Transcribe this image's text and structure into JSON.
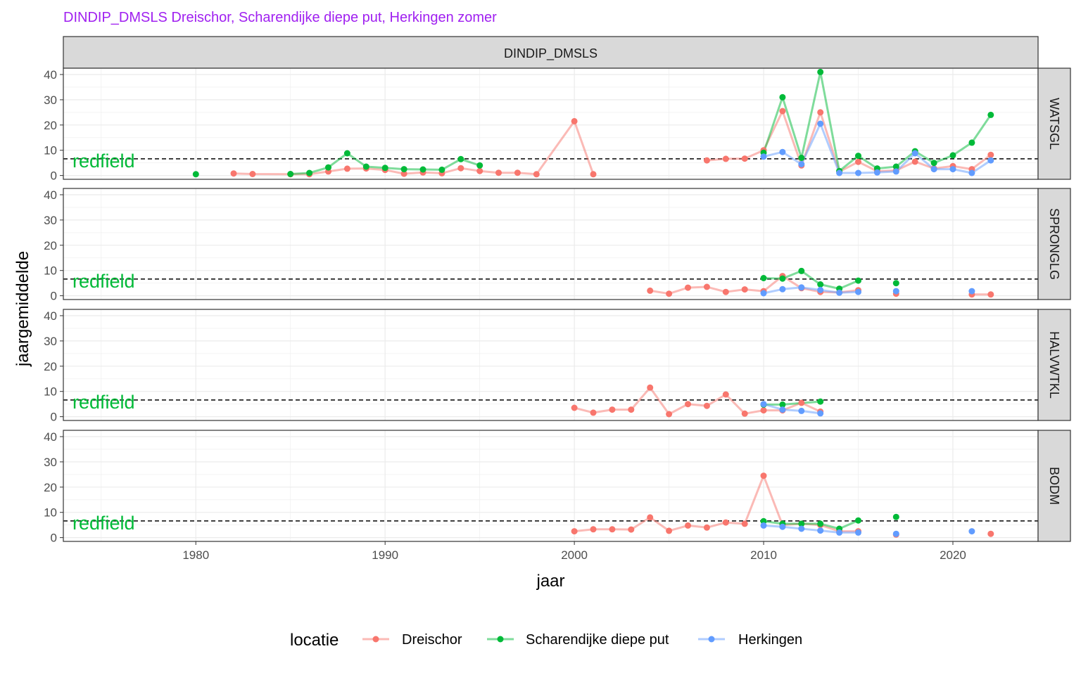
{
  "chart_data": {
    "type": "line",
    "title": "DINDIP_DMSLS Dreischor, Scharendijke diepe put, Herkingen zomer",
    "title_color": "#A020F0",
    "facet_column": "DINDIP_DMSLS",
    "xlabel": "jaar",
    "ylabel": "jaargemiddelde",
    "xlim": [
      1973,
      2024.5
    ],
    "ylim": [
      -1.5,
      42.5
    ],
    "x_ticks": [
      1980,
      1990,
      2000,
      2010,
      2020
    ],
    "y_ticks": [
      0,
      10,
      20,
      30,
      40
    ],
    "grid": true,
    "reference_line": {
      "y": 6.6,
      "label": "redfield",
      "color": "#00BA38",
      "style": "dashed"
    },
    "legend": {
      "title": "locatie",
      "position": "bottom"
    },
    "series_styles": [
      {
        "name": "Dreischor",
        "color": "#F8766D"
      },
      {
        "name": "Scharendijke diepe put",
        "color": "#00BA38"
      },
      {
        "name": "Herkingen",
        "color": "#619CFF"
      }
    ],
    "panels": [
      {
        "label": "WATSGL",
        "series": [
          {
            "name": "Dreischor",
            "segments": [
              [
                [
                  1982,
                  0.8
                ],
                [
                  1983,
                  0.6
                ],
                [
                  1985,
                  0.5
                ],
                [
                  1986,
                  0.5
                ],
                [
                  1987,
                  1.6
                ],
                [
                  1988,
                  2.7
                ],
                [
                  1989,
                  2.8
                ],
                [
                  1990,
                  2.2
                ],
                [
                  1991,
                  0.7
                ],
                [
                  1992,
                  1.2
                ],
                [
                  1993,
                  0.9
                ],
                [
                  1994,
                  2.9
                ],
                [
                  1995,
                  1.8
                ],
                [
                  1996,
                  1.1
                ],
                [
                  1997,
                  1.1
                ],
                [
                  1998,
                  0.5
                ],
                [
                  2000,
                  21.5
                ],
                [
                  2001,
                  0.5
                ]
              ],
              [
                [
                  2007,
                  6.0
                ],
                [
                  2008,
                  6.6
                ],
                [
                  2009,
                  6.7
                ],
                [
                  2010,
                  10.0
                ],
                [
                  2011,
                  25.5
                ],
                [
                  2012,
                  4.0
                ],
                [
                  2013,
                  25.0
                ],
                [
                  2014,
                  1.5
                ],
                [
                  2015,
                  5.4
                ],
                [
                  2016,
                  1.7
                ],
                [
                  2017,
                  2.0
                ],
                [
                  2018,
                  5.5
                ],
                [
                  2019,
                  2.8
                ],
                [
                  2020,
                  3.7
                ],
                [
                  2021,
                  2.5
                ],
                [
                  2022,
                  8.2
                ]
              ]
            ]
          },
          {
            "name": "Scharendijke diepe put",
            "segments": [
              [
                [
                  1980,
                  0.5
                ]
              ],
              [
                [
                  1985,
                  0.6
                ],
                [
                  1986,
                  1.0
                ],
                [
                  1987,
                  3.2
                ],
                [
                  1988,
                  8.8
                ],
                [
                  1989,
                  3.5
                ],
                [
                  1990,
                  3.0
                ],
                [
                  1991,
                  2.5
                ],
                [
                  1992,
                  2.4
                ],
                [
                  1993,
                  2.3
                ],
                [
                  1994,
                  6.5
                ],
                [
                  1995,
                  4.0
                ]
              ],
              [
                [
                  2010,
                  9.0
                ],
                [
                  2011,
                  31.0
                ],
                [
                  2012,
                  7.0
                ],
                [
                  2013,
                  41.0
                ],
                [
                  2014,
                  1.8
                ],
                [
                  2015,
                  7.8
                ],
                [
                  2016,
                  2.8
                ],
                [
                  2017,
                  3.5
                ],
                [
                  2018,
                  9.6
                ],
                [
                  2019,
                  5.0
                ],
                [
                  2020,
                  8.0
                ],
                [
                  2021,
                  13.0
                ],
                [
                  2022,
                  24.0
                ]
              ]
            ]
          },
          {
            "name": "Herkingen",
            "segments": [
              [
                [
                  2010,
                  7.5
                ],
                [
                  2011,
                  9.3
                ],
                [
                  2012,
                  4.5
                ],
                [
                  2013,
                  20.5
                ],
                [
                  2014,
                  1.0
                ],
                [
                  2015,
                  1.0
                ],
                [
                  2016,
                  1.2
                ],
                [
                  2017,
                  1.6
                ],
                [
                  2018,
                  8.8
                ],
                [
                  2019,
                  2.5
                ],
                [
                  2020,
                  2.5
                ],
                [
                  2021,
                  1.0
                ],
                [
                  2022,
                  6.0
                ]
              ]
            ]
          }
        ]
      },
      {
        "label": "SPRONGLG",
        "series": [
          {
            "name": "Dreischor",
            "segments": [
              [
                [
                  2004,
                  2.0
                ],
                [
                  2005,
                  0.8
                ],
                [
                  2006,
                  3.2
                ],
                [
                  2007,
                  3.5
                ],
                [
                  2008,
                  1.5
                ],
                [
                  2009,
                  2.5
                ],
                [
                  2010,
                  1.8
                ],
                [
                  2011,
                  7.8
                ],
                [
                  2012,
                  3.0
                ],
                [
                  2013,
                  1.5
                ],
                [
                  2014,
                  1.3
                ],
                [
                  2015,
                  2.2
                ]
              ],
              [
                [
                  2017,
                  0.8
                ]
              ],
              [
                [
                  2021,
                  0.5
                ],
                [
                  2022,
                  0.5
                ]
              ]
            ]
          },
          {
            "name": "Scharendijke diepe put",
            "segments": [
              [
                [
                  2010,
                  7.0
                ],
                [
                  2011,
                  6.8
                ],
                [
                  2012,
                  9.8
                ],
                [
                  2013,
                  4.5
                ],
                [
                  2014,
                  2.8
                ],
                [
                  2015,
                  6.0
                ]
              ],
              [
                [
                  2017,
                  5.0
                ]
              ]
            ]
          },
          {
            "name": "Herkingen",
            "segments": [
              [
                [
                  2010,
                  1.0
                ],
                [
                  2011,
                  2.6
                ],
                [
                  2012,
                  3.3
                ],
                [
                  2013,
                  2.3
                ],
                [
                  2014,
                  1.2
                ],
                [
                  2015,
                  1.5
                ]
              ],
              [
                [
                  2017,
                  1.8
                ]
              ],
              [
                [
                  2021,
                  1.8
                ]
              ]
            ]
          }
        ]
      },
      {
        "label": "HALVWTKL",
        "series": [
          {
            "name": "Dreischor",
            "segments": [
              [
                [
                  2000,
                  3.5
                ],
                [
                  2001,
                  1.6
                ],
                [
                  2002,
                  2.8
                ],
                [
                  2003,
                  2.8
                ],
                [
                  2004,
                  11.5
                ],
                [
                  2005,
                  1.0
                ],
                [
                  2006,
                  5.0
                ],
                [
                  2007,
                  4.3
                ],
                [
                  2008,
                  8.8
                ],
                [
                  2009,
                  1.2
                ],
                [
                  2010,
                  2.5
                ],
                [
                  2011,
                  2.5
                ],
                [
                  2012,
                  5.5
                ],
                [
                  2013,
                  2.0
                ]
              ]
            ]
          },
          {
            "name": "Scharendijke diepe put",
            "segments": [
              [
                [
                  2010,
                  4.8
                ],
                [
                  2011,
                  4.8
                ],
                [
                  2013,
                  6.0
                ]
              ]
            ]
          },
          {
            "name": "Herkingen",
            "segments": [
              [
                [
                  2010,
                  5.0
                ],
                [
                  2011,
                  2.8
                ],
                [
                  2012,
                  2.3
                ],
                [
                  2013,
                  1.3
                ]
              ]
            ]
          }
        ]
      },
      {
        "label": "BODM",
        "series": [
          {
            "name": "Dreischor",
            "segments": [
              [
                [
                  2000,
                  2.5
                ],
                [
                  2001,
                  3.3
                ],
                [
                  2002,
                  3.3
                ],
                [
                  2003,
                  3.2
                ],
                [
                  2004,
                  8.0
                ],
                [
                  2005,
                  2.7
                ],
                [
                  2006,
                  4.8
                ],
                [
                  2007,
                  4.0
                ],
                [
                  2008,
                  6.0
                ],
                [
                  2009,
                  5.5
                ],
                [
                  2010,
                  24.5
                ],
                [
                  2011,
                  5.0
                ],
                [
                  2012,
                  5.5
                ],
                [
                  2013,
                  5.0
                ],
                [
                  2014,
                  2.5
                ],
                [
                  2015,
                  2.5
                ]
              ],
              [
                [
                  2017,
                  1.2
                ]
              ],
              [
                [
                  2022,
                  1.5
                ]
              ]
            ]
          },
          {
            "name": "Scharendijke diepe put",
            "segments": [
              [
                [
                  2010,
                  6.5
                ],
                [
                  2011,
                  5.5
                ],
                [
                  2012,
                  5.5
                ],
                [
                  2013,
                  5.5
                ],
                [
                  2014,
                  3.5
                ],
                [
                  2015,
                  6.8
                ]
              ],
              [
                [
                  2017,
                  8.2
                ]
              ]
            ]
          },
          {
            "name": "Herkingen",
            "segments": [
              [
                [
                  2010,
                  4.8
                ],
                [
                  2011,
                  4.3
                ],
                [
                  2012,
                  3.5
                ],
                [
                  2013,
                  2.8
                ],
                [
                  2014,
                  2.0
                ],
                [
                  2015,
                  2.0
                ]
              ],
              [
                [
                  2017,
                  1.5
                ]
              ],
              [
                [
                  2021,
                  2.5
                ]
              ]
            ]
          }
        ]
      }
    ]
  }
}
